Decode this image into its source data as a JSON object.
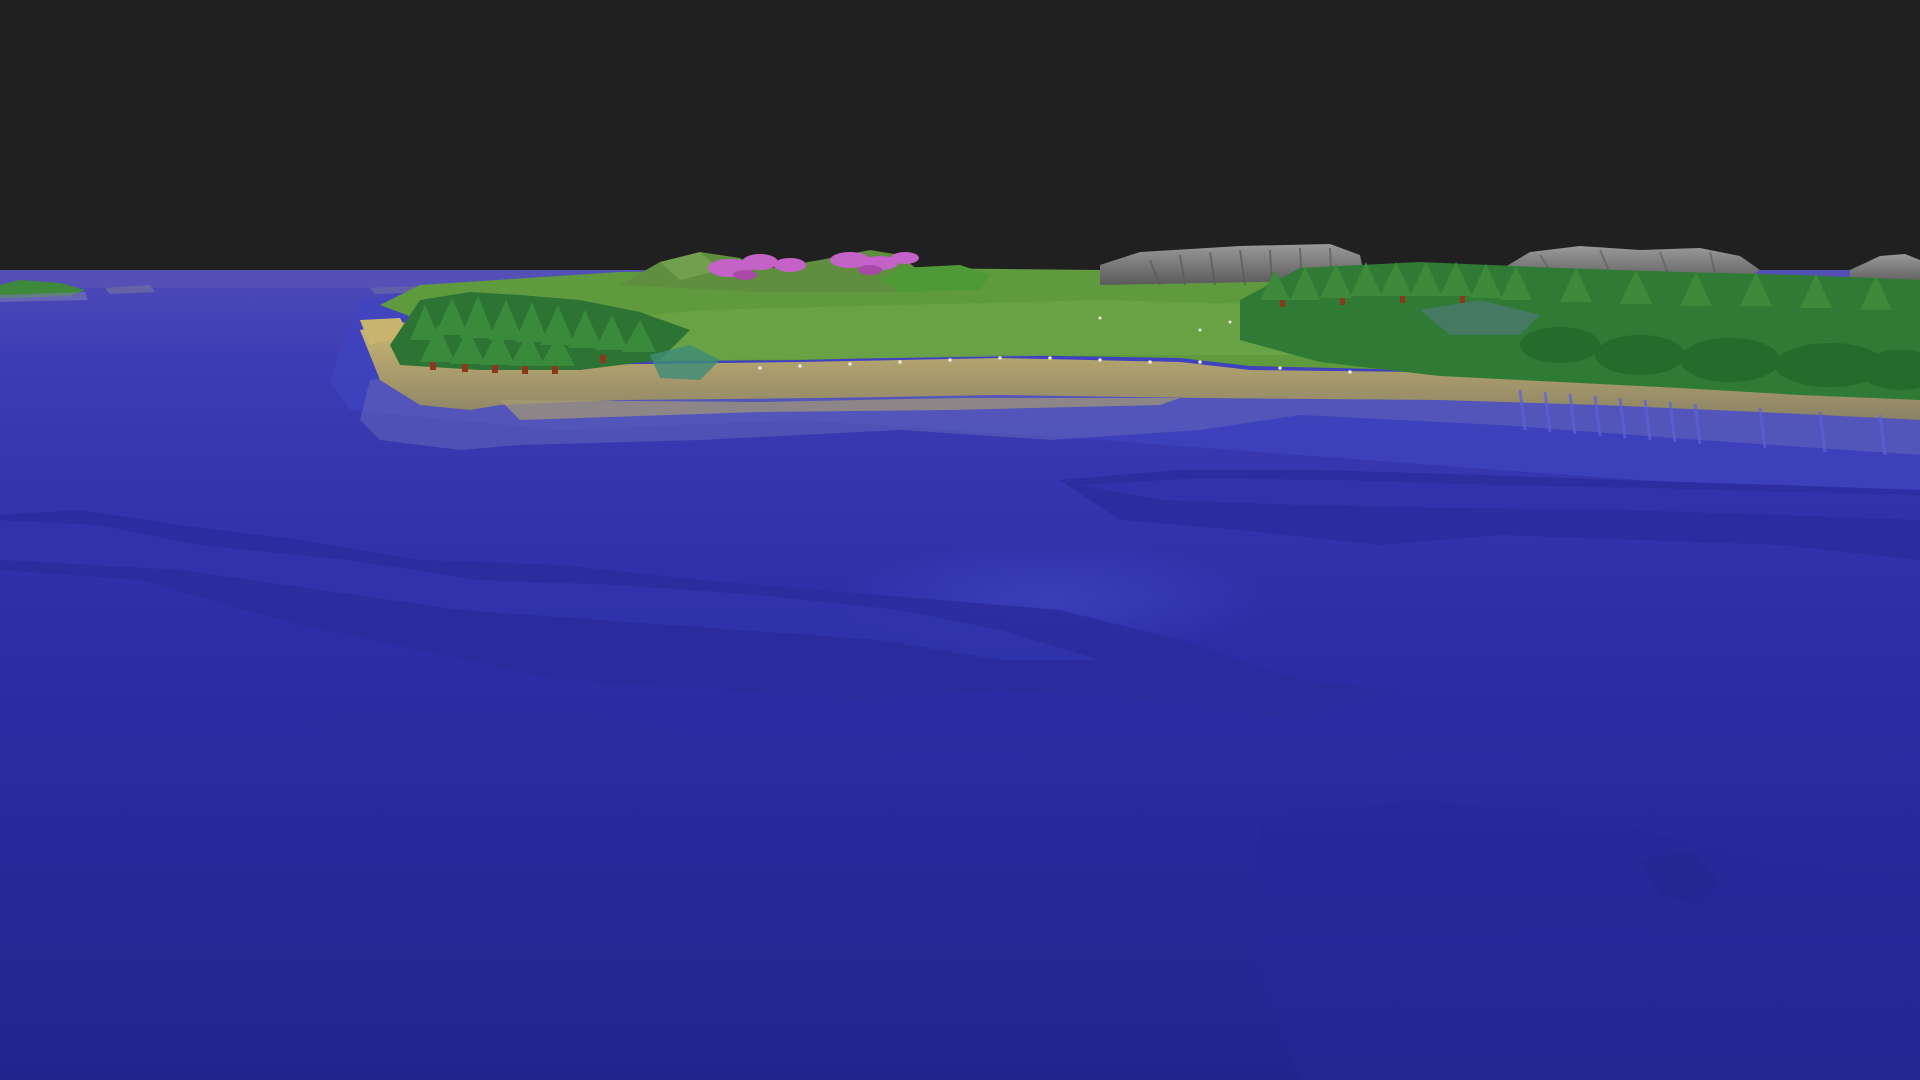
{
  "scene": {
    "type": "3d-terrain-view",
    "colors": {
      "sky": "#202020",
      "deep_water": "#23238a",
      "mid_water": "#2b2fa3",
      "shallow_water": "#3a3fc0",
      "horizon_water": "#4a47b5",
      "sand": "#c8b46e",
      "sand_shadow": "#8f8560",
      "grass": "#5e9a3e",
      "grass_light": "#7db34f",
      "forest": "#2f7a35",
      "forest_dark": "#1f5a2a",
      "rock": "#7a7a7a",
      "rock_light": "#9a9a9a",
      "blossom": "#c462c8",
      "trunk": "#8a3a1a"
    },
    "elements": {
      "sky": "sky",
      "ocean": "ocean",
      "seabed_ridges": "seabed-ridges",
      "coastline": "coastline",
      "beach": "beach",
      "grassland": "grassland",
      "forest_left": "forest-cluster",
      "forest_right": "forest-cluster",
      "hills": "hills",
      "rock_cliffs": "rock-cliffs",
      "blossom_trees": "blossom-trees",
      "distant_island": "distant-island"
    }
  }
}
